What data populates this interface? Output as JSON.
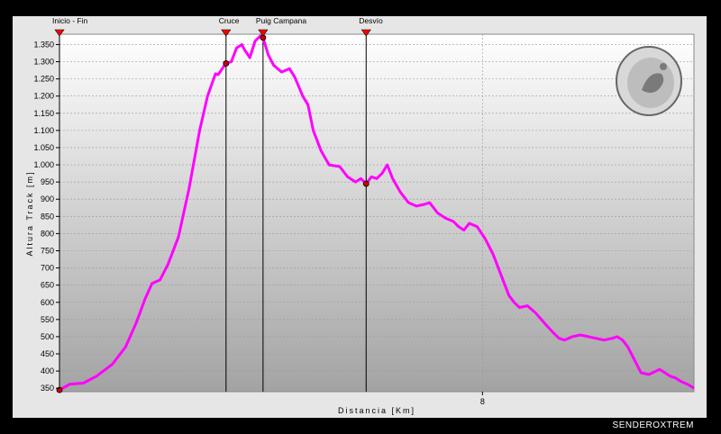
{
  "credit": "SENDEROXTREM",
  "chart_data": {
    "type": "line",
    "xlabel": "Distancia [Km]",
    "ylabel": "Altura Track [m]",
    "xlim": [
      0,
      12
    ],
    "ylim": [
      340,
      1380
    ],
    "y_ticks": [
      350,
      400,
      450,
      500,
      550,
      600,
      650,
      700,
      750,
      800,
      850,
      900,
      950,
      1000,
      1050,
      1100,
      1150,
      1200,
      1250,
      1300,
      1350
    ],
    "y_tick_labels": [
      "350",
      "400",
      "450",
      "500",
      "550",
      "600",
      "650",
      "700",
      "750",
      "800",
      "850",
      "900",
      "950",
      "1.000",
      "1.050",
      "1.100",
      "1.150",
      "1.200",
      "1.250",
      "1.300",
      "1.350"
    ],
    "x_ticks": [
      8
    ],
    "x_tick_labels": [
      "8"
    ],
    "grid": true,
    "line_color": "#ff00ff",
    "marker_color": "#cc0000",
    "waypoints": [
      {
        "name": "Inicio - Fin",
        "x": 0.0,
        "y": 345
      },
      {
        "name": "Cruce",
        "x": 3.15,
        "y": 1295
      },
      {
        "name": "Puig Campana",
        "x": 3.85,
        "y": 1370
      },
      {
        "name": "Desvío",
        "x": 5.8,
        "y": 945
      }
    ],
    "series": [
      {
        "x": [
          0,
          0.2,
          0.45,
          0.7,
          1.0,
          1.25,
          1.45,
          1.62,
          1.75,
          1.9,
          2.05,
          2.25,
          2.45,
          2.65,
          2.8,
          2.95,
          3.0,
          3.1,
          3.15,
          3.25,
          3.35,
          3.45,
          3.5,
          3.6,
          3.7,
          3.8,
          3.85,
          3.95,
          4.05,
          4.2,
          4.35,
          4.45,
          4.6,
          4.7,
          4.8,
          4.95,
          5.1,
          5.3,
          5.45,
          5.6,
          5.7,
          5.8,
          5.9,
          6.0,
          6.1,
          6.2,
          6.3,
          6.45,
          6.6,
          6.75,
          6.9,
          7.0,
          7.15,
          7.3,
          7.45,
          7.55,
          7.65,
          7.75,
          7.9,
          8.05,
          8.2,
          8.4,
          8.5,
          8.6,
          8.7,
          8.85,
          9.0,
          9.2,
          9.35,
          9.45,
          9.55,
          9.7,
          9.85,
          10.0,
          10.15,
          10.3,
          10.45,
          10.55,
          10.65,
          10.75,
          10.85,
          11.0,
          11.15,
          11.35,
          11.55,
          11.65,
          11.75,
          11.9,
          12.0
        ],
        "y": [
          345,
          362,
          365,
          385,
          420,
          470,
          540,
          610,
          655,
          665,
          710,
          790,
          930,
          1100,
          1200,
          1265,
          1262,
          1285,
          1295,
          1300,
          1340,
          1350,
          1335,
          1312,
          1360,
          1375,
          1370,
          1320,
          1290,
          1270,
          1280,
          1255,
          1200,
          1175,
          1100,
          1040,
          1000,
          995,
          965,
          950,
          960,
          945,
          965,
          960,
          975,
          1000,
          960,
          920,
          890,
          880,
          885,
          890,
          860,
          845,
          835,
          820,
          810,
          830,
          820,
          785,
          740,
          660,
          620,
          600,
          585,
          590,
          570,
          535,
          510,
          495,
          490,
          500,
          505,
          500,
          495,
          490,
          495,
          500,
          490,
          470,
          440,
          395,
          390,
          405,
          385,
          380,
          370,
          360,
          350
        ]
      }
    ]
  }
}
